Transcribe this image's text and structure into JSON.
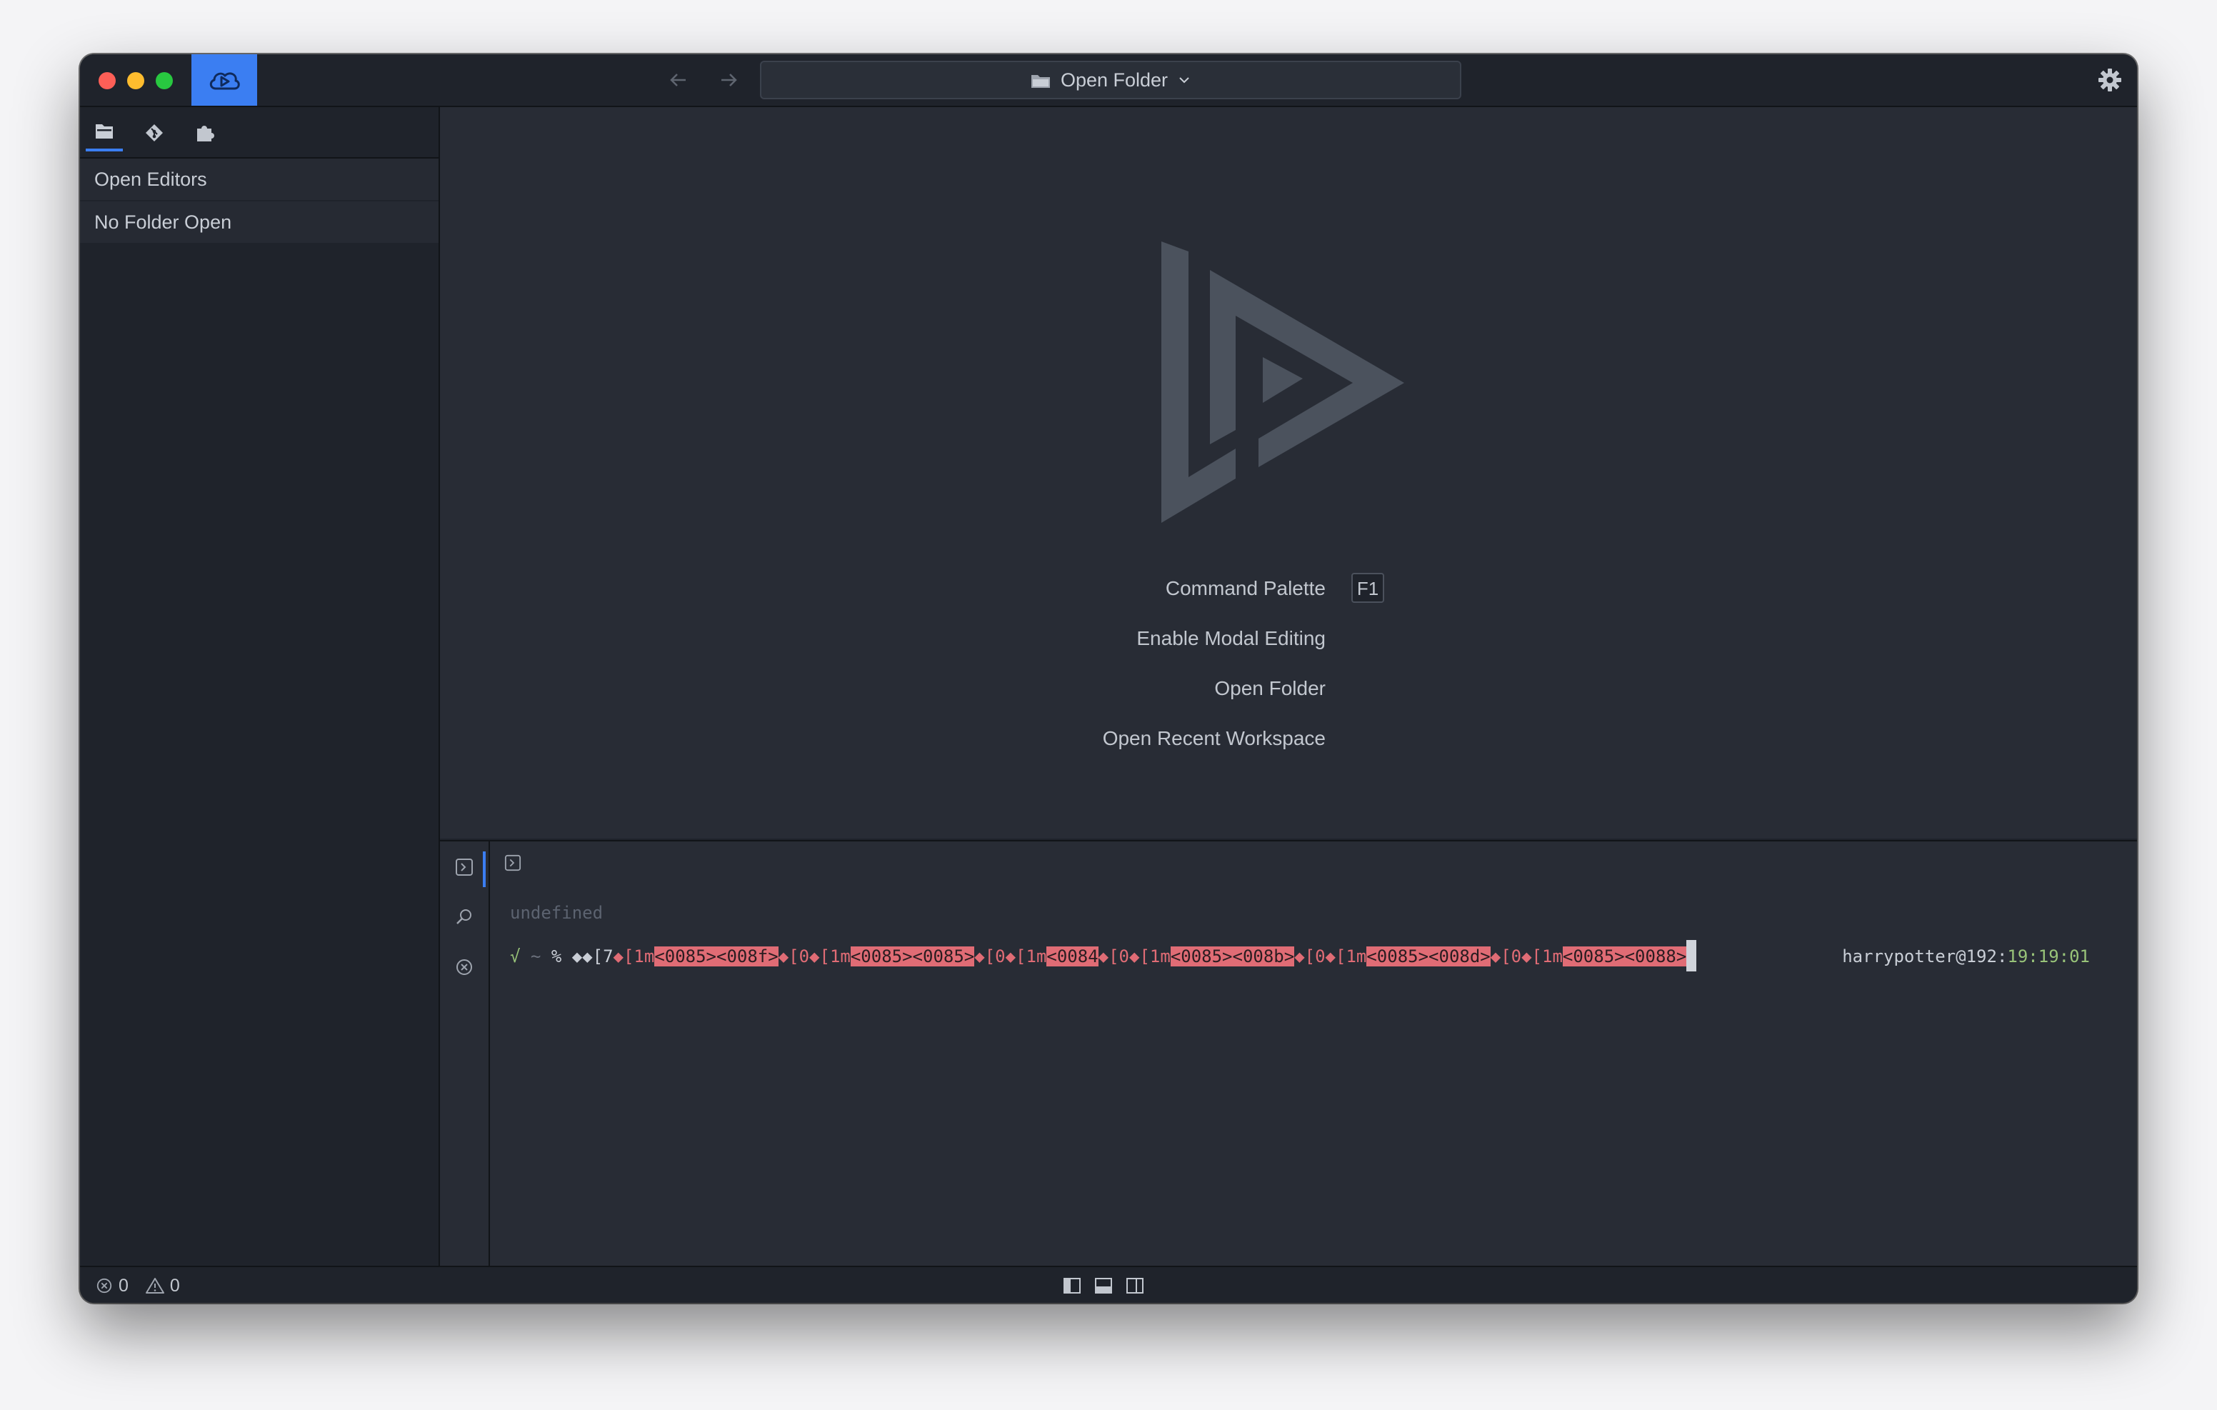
{
  "titlebar": {
    "command_label": "Open Folder",
    "icons": [
      "cloud-icon",
      "arrow-left-icon",
      "arrow-right-icon",
      "folder-icon",
      "chevron-down-icon",
      "gear-icon"
    ]
  },
  "sidebar": {
    "tabs": [
      "files-icon",
      "git-icon",
      "extensions-icon"
    ],
    "items": [
      {
        "label": "Open Editors"
      },
      {
        "label": "No Folder Open"
      }
    ]
  },
  "welcome": {
    "commands": [
      {
        "label": "Command Palette",
        "shortcut": "F1"
      },
      {
        "label": "Enable Modal Editing"
      },
      {
        "label": "Open Folder"
      },
      {
        "label": "Open Recent Workspace"
      }
    ]
  },
  "terminal": {
    "status_line": "undefined",
    "prompt_check": "√",
    "prompt_dir": "~",
    "prompt_sym": "%",
    "segments": [
      {
        "text": "◆◆[7",
        "style": "plain"
      },
      {
        "text": "◆[1m",
        "style": "esc"
      },
      {
        "text": "<0085><008f>",
        "style": "hl"
      },
      {
        "text": "◆[0◆[1m",
        "style": "esc"
      },
      {
        "text": "<0085><0085>",
        "style": "hl"
      },
      {
        "text": "◆[0◆[1m",
        "style": "esc"
      },
      {
        "text": "<0084",
        "style": "hl"
      },
      {
        "text": "◆[0◆[1m",
        "style": "esc"
      },
      {
        "text": "<0085><008b>",
        "style": "hl"
      },
      {
        "text": "◆[0◆[1m",
        "style": "esc"
      },
      {
        "text": "<0085><008d>",
        "style": "hl"
      },
      {
        "text": "◆[0◆[1m",
        "style": "esc"
      },
      {
        "text": "<0085><0088>",
        "style": "hl"
      }
    ],
    "right_user": "harrypotter@192:",
    "right_time": "19:19:01"
  },
  "statusbar": {
    "errors": "0",
    "warnings": "0"
  },
  "colors": {
    "accent": "#3b7ef2",
    "background": "#282c35",
    "sidebar": "#1f232b",
    "error_highlight": "#e06c75",
    "success": "#98c379"
  }
}
